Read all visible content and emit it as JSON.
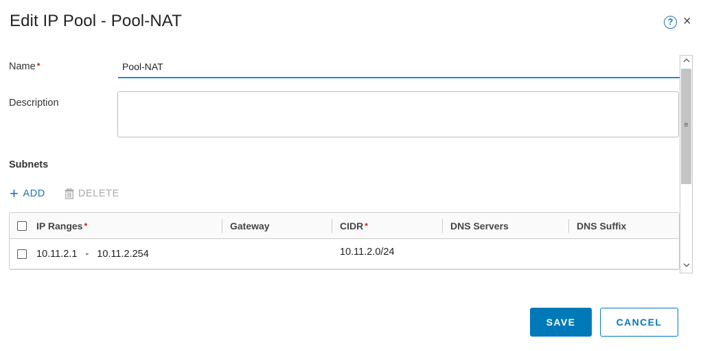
{
  "dialog": {
    "title": "Edit IP Pool - Pool-NAT",
    "help_icon": "?",
    "close_icon": "×"
  },
  "form": {
    "name_label": "Name",
    "required_marker": "*",
    "name_value": "Pool-NAT",
    "description_label": "Description",
    "description_value": ""
  },
  "subnets": {
    "heading": "Subnets",
    "add_label": "ADD",
    "delete_label": "DELETE",
    "columns": [
      "IP Ranges",
      "Gateway",
      "CIDR",
      "DNS Servers",
      "DNS Suffix"
    ],
    "rows": [
      {
        "ip_range_start": "10.11.2.1",
        "range_separator": "-",
        "ip_range_end": "10.11.2.254",
        "gateway": "",
        "cidr": "10.11.2.0/24",
        "dns_servers": "",
        "dns_suffix": ""
      }
    ]
  },
  "footer": {
    "save_label": "SAVE",
    "cancel_label": "CANCEL"
  },
  "colors": {
    "accent": "#0079b8",
    "required": "#c92100"
  },
  "icons": {
    "add": "plus-icon",
    "delete": "trash-icon",
    "help": "help-circle-icon",
    "close": "close-icon"
  }
}
